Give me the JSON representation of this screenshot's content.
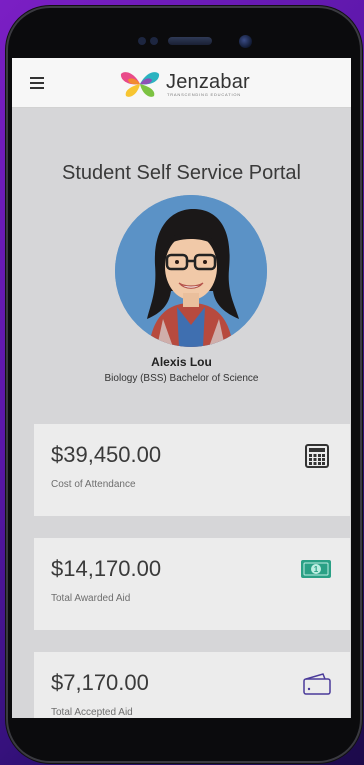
{
  "app": {
    "brand_name": "Jenzabar",
    "brand_tagline": "TRANSCENDING EDUCATION"
  },
  "portal": {
    "title": "Student Self Service Portal"
  },
  "student": {
    "name": "Alexis Lou",
    "program": "Biology (BSS) Bachelor of Science"
  },
  "cards": [
    {
      "amount": "$39,450.00",
      "label": "Cost of Attendance",
      "icon": "calculator-icon"
    },
    {
      "amount": "$14,170.00",
      "label": "Total Awarded Aid",
      "icon": "money-bill-icon",
      "icon_color": "#2aa085"
    },
    {
      "amount": "$7,170.00",
      "label": "Total Accepted Aid",
      "icon": "wallet-icon",
      "icon_color": "#4a3a9a"
    }
  ],
  "colors": {
    "background_accent": "#6a1bb8",
    "topbar": "#f7f7f7",
    "screen_background": "#d6d6d8",
    "card_background": "#ececec"
  }
}
